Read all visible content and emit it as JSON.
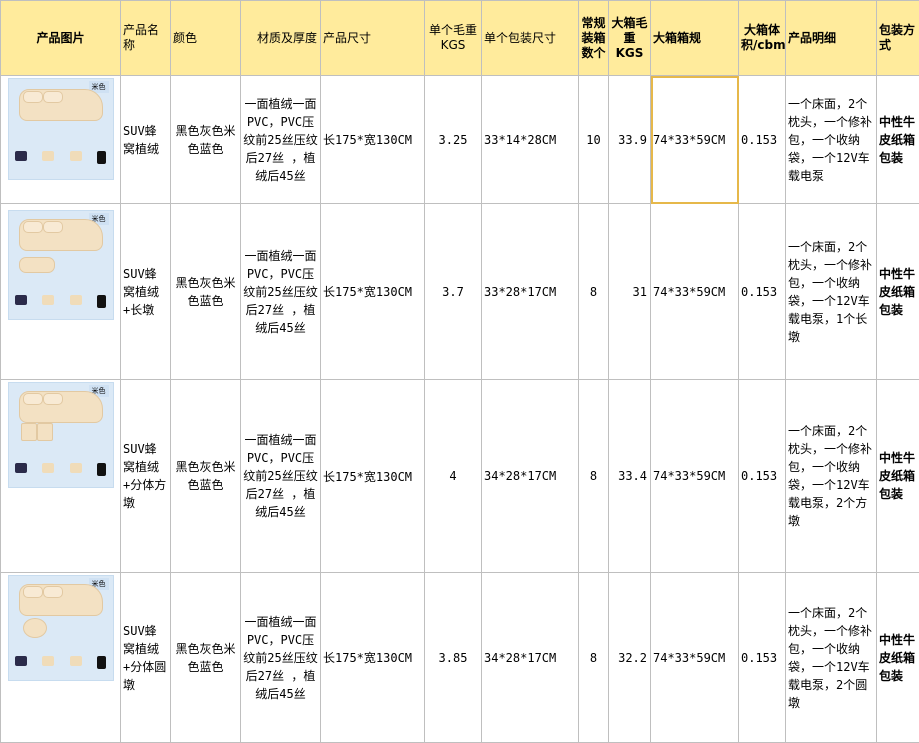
{
  "headers": {
    "image": "产品图片",
    "name": "产品名称",
    "color": "颜色",
    "material": "材质及厚度",
    "size": "产品尺寸",
    "unit_weight": "单个毛重KGS",
    "unit_pack_size": "单个包装尺寸",
    "qty_per_carton": "常规装箱数个",
    "carton_weight": "大箱毛重KGS",
    "carton_size": "大箱箱规",
    "carton_volume": "大箱体积/cbm",
    "details": "产品明细",
    "packing": "包装方式"
  },
  "rows": [
    {
      "image_tag": "米色",
      "name": "SUV蜂窝植绒",
      "color": "黑色灰色米色蓝色",
      "material": "一面植绒一面PVC，PVC压纹前25丝压纹后27丝 ，植绒后45丝",
      "size": "长175*宽130CM",
      "unit_weight": "3.25",
      "unit_pack_size": "33*14*28CM",
      "qty_per_carton": "10",
      "carton_weight": "33.9",
      "carton_size": "74*33*59CM",
      "carton_volume": "0.153",
      "details": "一个床面，2个枕头，一个修补包，一个收纳袋，一个12V车载电泵",
      "packing": "中性牛皮纸箱包装"
    },
    {
      "image_tag": "米色",
      "name": "SUV蜂窝植绒+长墩",
      "color": "黑色灰色米色蓝色",
      "material": "一面植绒一面PVC，PVC压纹前25丝压纹后27丝 ，植绒后45丝",
      "size": "长175*宽130CM",
      "unit_weight": "3.7",
      "unit_pack_size": "33*28*17CM",
      "qty_per_carton": "8",
      "carton_weight": "31",
      "carton_size": "74*33*59CM",
      "carton_volume": "0.153",
      "details": "一个床面，2个枕头，一个修补包，一个收纳袋，一个12V车载电泵，1个长墩",
      "packing": "中性牛皮纸箱包装"
    },
    {
      "image_tag": "米色",
      "name": "SUV蜂窝植绒+分体方墩",
      "color": "黑色灰色米色蓝色",
      "material": "一面植绒一面PVC，PVC压纹前25丝压纹后27丝 ，植绒后45丝",
      "size": "长175*宽130CM",
      "unit_weight": "4",
      "unit_pack_size": "34*28*17CM",
      "qty_per_carton": "8",
      "carton_weight": "33.4",
      "carton_size": "74*33*59CM",
      "carton_volume": "0.153",
      "details": "一个床面，2个枕头，一个修补包，一个收纳袋，一个12V车载电泵，2个方墩",
      "packing": "中性牛皮纸箱包装"
    },
    {
      "image_tag": "米色",
      "name": "SUV蜂窝植绒+分体圆墩",
      "color": "黑色灰色米色蓝色",
      "material": "一面植绒一面PVC，PVC压纹前25丝压纹后27丝 ，植绒后45丝",
      "size": "长175*宽130CM",
      "unit_weight": "3.85",
      "unit_pack_size": "34*28*17CM",
      "qty_per_carton": "8",
      "carton_weight": "32.2",
      "carton_size": "74*33*59CM",
      "carton_volume": "0.153",
      "details": "一个床面，2个枕头，一个修补包，一个收纳袋，一个12V车载电泵，2个圆墩",
      "packing": "中性牛皮纸箱包装"
    }
  ]
}
